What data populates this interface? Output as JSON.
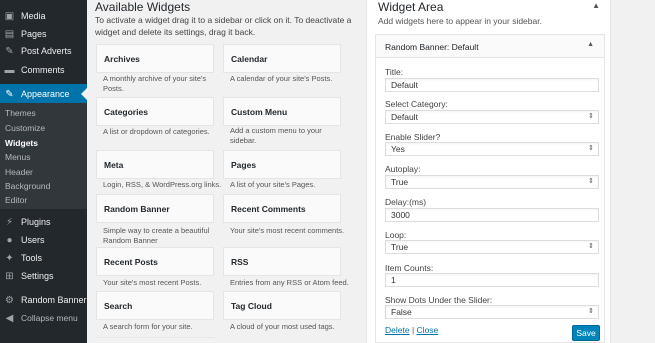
{
  "sidebar": {
    "items": [
      {
        "label": "Media",
        "icon": "media-icon"
      },
      {
        "label": "Pages",
        "icon": "pages-icon"
      },
      {
        "label": "Post Adverts",
        "icon": "pin-icon"
      },
      {
        "label": "Comments",
        "icon": "comments-icon"
      },
      {
        "label": "Appearance",
        "icon": "appearance-icon"
      },
      {
        "label": "Plugins",
        "icon": "plugins-icon"
      },
      {
        "label": "Users",
        "icon": "users-icon"
      },
      {
        "label": "Tools",
        "icon": "tools-icon"
      },
      {
        "label": "Settings",
        "icon": "settings-icon"
      },
      {
        "label": "Random Banner",
        "icon": "gear-icon"
      },
      {
        "label": "Collapse menu",
        "icon": "collapse-icon"
      }
    ],
    "submenu": [
      "Themes",
      "Customize",
      "Widgets",
      "Menus",
      "Header",
      "Background",
      "Editor"
    ]
  },
  "available": {
    "title": "Available Widgets",
    "description": "To activate a widget drag it to a sidebar or click on it. To deactivate a widget and delete its settings, drag it back.",
    "widgets": [
      {
        "name": "Archives",
        "desc": "A monthly archive of your site's Posts."
      },
      {
        "name": "Calendar",
        "desc": "A calendar of your site's Posts."
      },
      {
        "name": "Categories",
        "desc": "A list or dropdown of categories."
      },
      {
        "name": "Custom Menu",
        "desc": "Add a custom menu to your sidebar."
      },
      {
        "name": "Meta",
        "desc": "Login, RSS, & WordPress.org links."
      },
      {
        "name": "Pages",
        "desc": "A list of your site's Pages."
      },
      {
        "name": "Random Banner",
        "desc": "Simple way to create a beautiful Random Banner"
      },
      {
        "name": "Recent Comments",
        "desc": "Your site's most recent comments."
      },
      {
        "name": "Recent Posts",
        "desc": "Your site's most recent Posts."
      },
      {
        "name": "RSS",
        "desc": "Entries from any RSS or Atom feed."
      },
      {
        "name": "Search",
        "desc": "A search form for your site."
      },
      {
        "name": "Tag Cloud",
        "desc": "A cloud of your most used tags."
      }
    ]
  },
  "area": {
    "title": "Widget Area",
    "description": "Add widgets here to appear in your sidebar.",
    "widget_title": "Random Banner",
    "widget_subtitle": ": Default",
    "fields": {
      "title_label": "Title:",
      "title_value": "Default",
      "category_label": "Select Category:",
      "category_value": "Default",
      "slider_label": "Enable Slider?",
      "slider_value": "Yes",
      "autoplay_label": "Autoplay:",
      "autoplay_value": "True",
      "delay_label": "Delay:(ms)",
      "delay_value": "3000",
      "loop_label": "Loop:",
      "loop_value": "True",
      "count_label": "Item Counts:",
      "count_value": "1",
      "dots_label": "Show Dots Under the Slider:",
      "dots_value": "False"
    },
    "delete_label": "Delete",
    "separator": "|",
    "close_label": "Close",
    "save_label": "Save"
  },
  "colors": {
    "accent": "#0073aa",
    "sidebar": "#23282d",
    "submenu": "#32373c",
    "button": "#0085ba"
  }
}
